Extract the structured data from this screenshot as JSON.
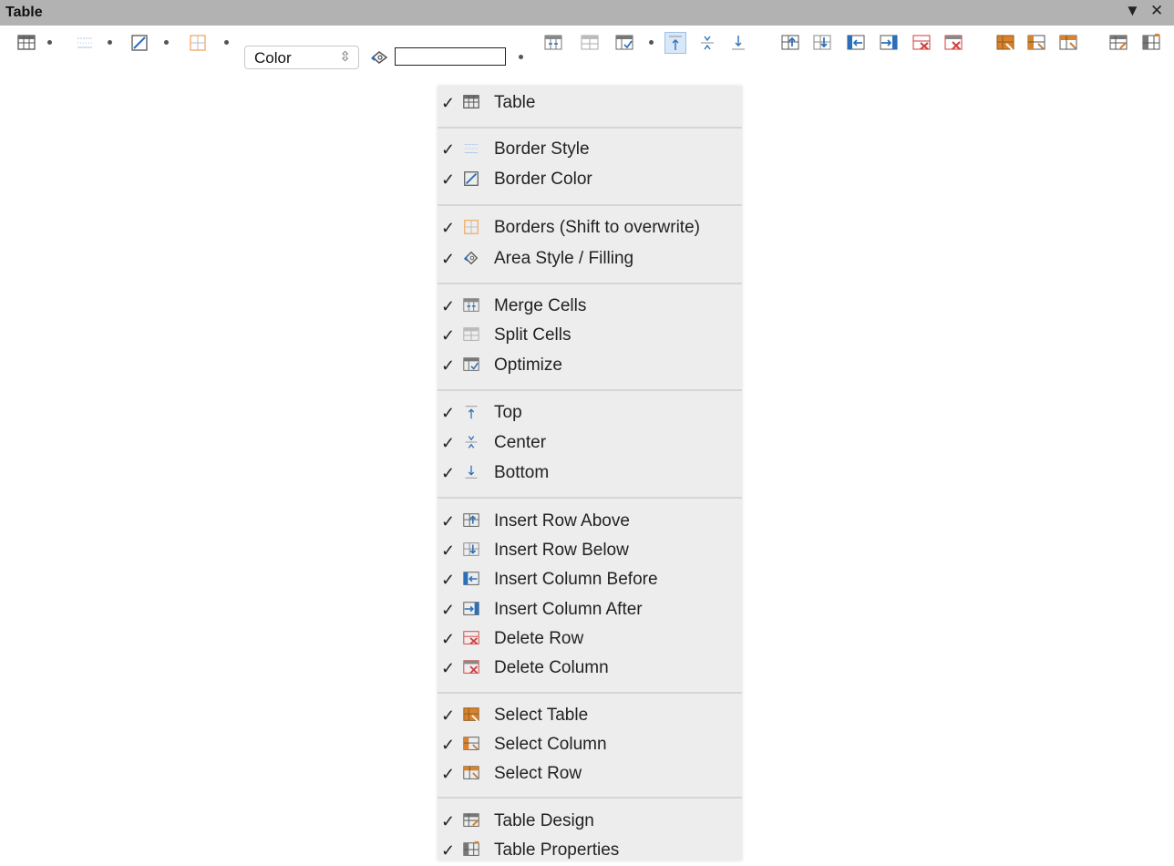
{
  "window": {
    "title": "Table",
    "dropdown_glyph": "▼",
    "close_glyph": "✕"
  },
  "toolbar": {
    "area_style_value": "Color",
    "items": [
      "Table",
      "Border Style",
      "Border Color",
      "Borders (Shift to overwrite)",
      "Area Style / Filling",
      "Merge Cells",
      "Split Cells",
      "Optimize",
      "Top",
      "Center",
      "Bottom",
      "Insert Row Above",
      "Insert Row Below",
      "Insert Column Before",
      "Insert Column After",
      "Delete Row",
      "Delete Column",
      "Select Table",
      "Select Column",
      "Select Row",
      "Table Design",
      "Table Properties"
    ]
  },
  "menu": {
    "check_glyph": "✓",
    "items": [
      {
        "label": "Table",
        "icon": "table-icon",
        "checked": true
      },
      {
        "label": "Border Style",
        "icon": "border-style-icon",
        "checked": true
      },
      {
        "label": "Border Color",
        "icon": "border-color-icon",
        "checked": true
      },
      {
        "label": "Borders (Shift to overwrite)",
        "icon": "borders-icon",
        "checked": true
      },
      {
        "label": "Area Style / Filling",
        "icon": "area-fill-icon",
        "checked": true
      },
      {
        "label": "Merge Cells",
        "icon": "merge-cells-icon",
        "checked": true
      },
      {
        "label": "Split Cells",
        "icon": "split-cells-icon",
        "checked": true
      },
      {
        "label": "Optimize",
        "icon": "optimize-icon",
        "checked": true
      },
      {
        "label": "Top",
        "icon": "align-top-icon",
        "checked": true
      },
      {
        "label": "Center",
        "icon": "align-center-icon",
        "checked": true
      },
      {
        "label": "Bottom",
        "icon": "align-bottom-icon",
        "checked": true
      },
      {
        "label": "Insert Row Above",
        "icon": "insert-row-above-icon",
        "checked": true
      },
      {
        "label": "Insert Row Below",
        "icon": "insert-row-below-icon",
        "checked": true
      },
      {
        "label": "Insert Column Before",
        "icon": "insert-column-before-icon",
        "checked": true
      },
      {
        "label": "Insert Column After",
        "icon": "insert-column-after-icon",
        "checked": true
      },
      {
        "label": "Delete Row",
        "icon": "delete-row-icon",
        "checked": true
      },
      {
        "label": "Delete Column",
        "icon": "delete-column-icon",
        "checked": true
      },
      {
        "label": "Select Table",
        "icon": "select-table-icon",
        "checked": true
      },
      {
        "label": "Select Column",
        "icon": "select-column-icon",
        "checked": true
      },
      {
        "label": "Select Row",
        "icon": "select-row-icon",
        "checked": true
      },
      {
        "label": "Table Design",
        "icon": "table-design-icon",
        "checked": true
      },
      {
        "label": "Table Properties",
        "icon": "table-properties-icon",
        "checked": true
      }
    ]
  },
  "colors": {
    "title_bar": "#b2b2b2",
    "menu_bg": "#ededed",
    "active_button": "#d8e8f8",
    "blue_icon": "#2a6fb8",
    "red_icon": "#d23b3b",
    "orange_icon": "#d9822b"
  }
}
